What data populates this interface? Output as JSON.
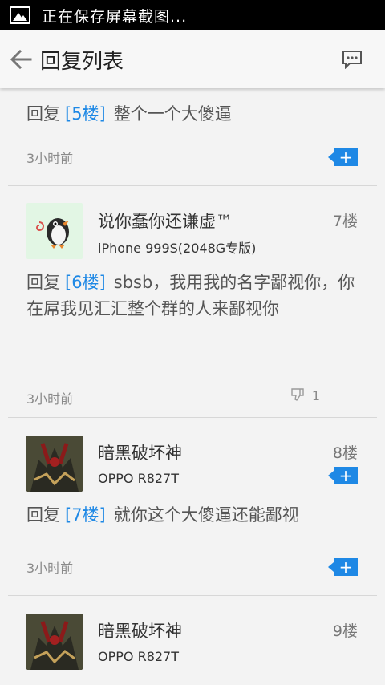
{
  "status_bar": {
    "text": "正在保存屏幕截图..."
  },
  "app_bar": {
    "title": "回复列表"
  },
  "reply_prefix": "回复",
  "replies": [
    {
      "reply_to": "[5楼]",
      "content": "整个一个大傻逼",
      "time": "3小时前",
      "add_label": "+"
    },
    {
      "user": "说你蠢你还谦虚™",
      "device": "iPhone 999S(2048G专版)",
      "floor": "7楼",
      "reply_to": "[6楼]",
      "content": "sbsb，我用我的名字鄙视你，你在屌我见汇汇整个群的人来鄙视你",
      "time": "3小时前",
      "dislike_count": "1",
      "add_label": "+"
    },
    {
      "user": "暗黑破坏神",
      "device": "OPPO R827T",
      "floor": "8楼",
      "reply_to": "[7楼]",
      "content": "就你这个大傻逼还能鄙视",
      "time": "3小时前",
      "add_label": "+"
    },
    {
      "user": "暗黑破坏神",
      "device": "OPPO R827T",
      "floor": "9楼"
    }
  ],
  "colors": {
    "accent": "#1e88e5",
    "background": "#f3f3f3"
  },
  "icons": {
    "back": "arrow-left-icon",
    "comment": "comment-icon",
    "dislike": "thumbs-down-icon",
    "status": "image-icon"
  }
}
